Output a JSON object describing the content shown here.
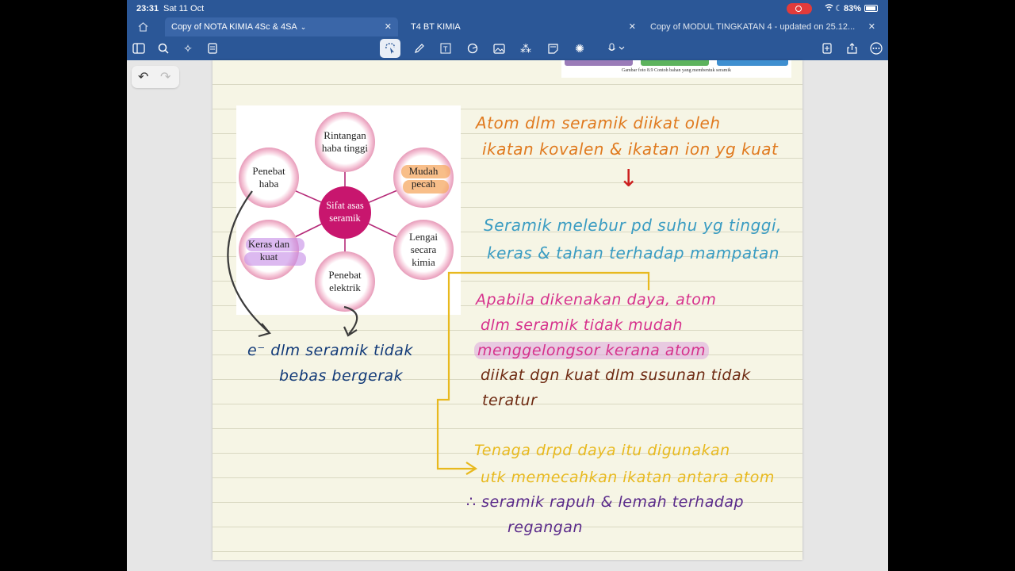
{
  "status": {
    "time": "23:31",
    "date": "Sat 11 Oct",
    "battery": "83%"
  },
  "tabs": [
    {
      "label": "Copy of NOTA KIMIA 4Sc & 4SA"
    },
    {
      "label": "T4 BT KIMIA"
    },
    {
      "label": "Copy of MODUL TINGKATAN 4 - updated on 25.12..."
    }
  ],
  "toolbar": {
    "icons": [
      "sidebar-icon",
      "search-icon",
      "sparkle-icon",
      "document-icon",
      "lasso-icon",
      "pen-icon",
      "textbox-icon",
      "shapes-icon",
      "image-icon",
      "elements-icon",
      "sticky-note-icon",
      "laser-icon",
      "microphone-icon",
      "add-page-icon",
      "share-icon",
      "more-icon"
    ]
  },
  "document": {
    "photo_caption": "Gambar foto 8.9 Contoh bahan yang membentuk seramik",
    "figure": {
      "center": "Sifat asas seramik",
      "nodes": [
        {
          "text": "Rintangan haba tinggi"
        },
        {
          "text": "Mudah pecah"
        },
        {
          "text": "Lengai secara kimia"
        },
        {
          "text": "Penebat elektrik"
        },
        {
          "text": "Keras dan kuat"
        },
        {
          "text": "Penebat haba"
        }
      ]
    },
    "notes": {
      "line1a": "Atom dlm seramik diikat oleh",
      "line1b": "ikatan kovalen & ikatan ion yg kuat",
      "arrow": "↓",
      "line2a": "Seramik melebur pd suhu yg tinggi,",
      "line2b": "keras & tahan terhadap mampatan",
      "line3a": "Apabila dikenakan daya, atom",
      "line3b": "dlm seramik tidak mudah",
      "line3c": "menggelongsor kerana atom",
      "line3d": "diikat dgn kuat dlm susunan tidak",
      "line3e": "teratur",
      "line4a": "Tenaga drpd daya itu digunakan",
      "line4b": "utk memecahkan ikatan antara atom",
      "line4c": "∴ seramik rapuh & lemah terhadap",
      "line4d": "regangan",
      "left1": "e⁻ dlm seramik tidak",
      "left2": "bebas bergerak"
    }
  },
  "colors": {
    "chrome": "#2b5797",
    "orange_ink": "#e07a1f",
    "teal_ink": "#3a9cc2",
    "pink_ink": "#d6318c",
    "brown_ink": "#6e2a12",
    "yellow_ink": "#e8b91e",
    "navy_ink": "#123a78",
    "purple_ink": "#5a2a8a",
    "red_arrow": "#cc1f1f",
    "magenta_node": "#c8166e"
  }
}
